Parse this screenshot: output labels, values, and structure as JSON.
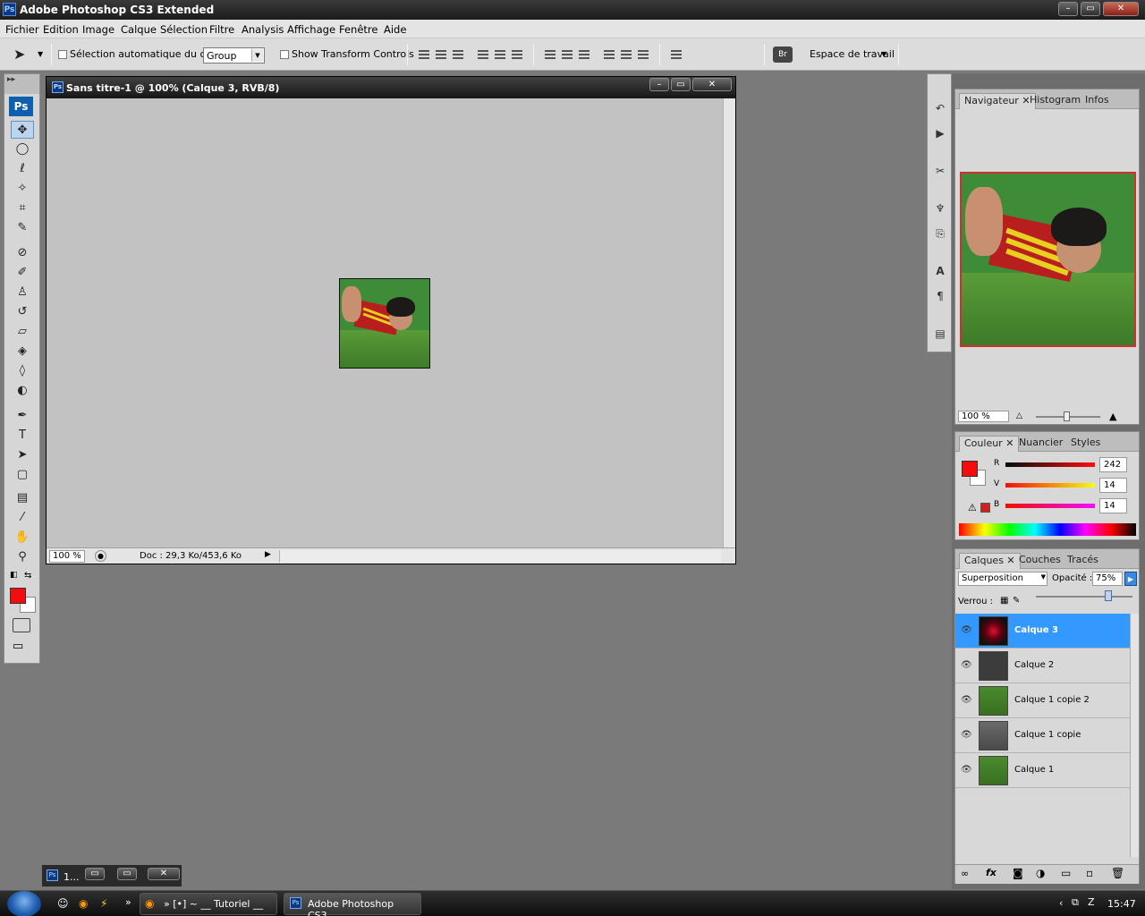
{
  "app": {
    "title": "Adobe Photoshop CS3 Extended",
    "logo": "Ps",
    "window_controls": {
      "minimize": "–",
      "maximize": "▭",
      "close": "✕"
    }
  },
  "menu": [
    "Fichier",
    "Edition",
    "Image",
    "Calque",
    "Sélection",
    "Filtre",
    "Analysis",
    "Affichage",
    "Fenêtre",
    "Aide"
  ],
  "options_bar": {
    "auto_select_label": "Sélection automatique du calque",
    "auto_select_value": "Group",
    "transform_label": "Show Transform Controls",
    "workspace_label": "Espace de travail"
  },
  "tools": {
    "logo": "Ps",
    "items": [
      {
        "name": "move-tool-icon",
        "glyph": "✥"
      },
      {
        "name": "ellipse-marquee-icon",
        "glyph": "◯"
      },
      {
        "name": "lasso-icon",
        "glyph": "ℓ"
      },
      {
        "name": "magic-wand-icon",
        "glyph": "✧"
      },
      {
        "name": "crop-icon",
        "glyph": "⌗"
      },
      {
        "name": "slice-icon",
        "glyph": "✎"
      },
      {
        "name": "healing-brush-icon",
        "glyph": "⊘"
      },
      {
        "name": "brush-icon",
        "glyph": "✐"
      },
      {
        "name": "clone-stamp-icon",
        "glyph": "♙"
      },
      {
        "name": "history-brush-icon",
        "glyph": "↺"
      },
      {
        "name": "eraser-icon",
        "glyph": "▱"
      },
      {
        "name": "paint-bucket-icon",
        "glyph": "◈"
      },
      {
        "name": "blur-icon",
        "glyph": "◊"
      },
      {
        "name": "dodge-icon",
        "glyph": "◐"
      },
      {
        "name": "pen-icon",
        "glyph": "✒"
      },
      {
        "name": "type-icon",
        "glyph": "T"
      },
      {
        "name": "path-select-icon",
        "glyph": "➤"
      },
      {
        "name": "rectangle-shape-icon",
        "glyph": "▢"
      },
      {
        "name": "notes-icon",
        "glyph": "▤"
      },
      {
        "name": "eyedropper-icon",
        "glyph": "⁄"
      },
      {
        "name": "hand-icon",
        "glyph": "✋"
      },
      {
        "name": "zoom-icon",
        "glyph": "⚲"
      }
    ],
    "foreground_color": "#f20e0e",
    "background_color": "#ffffff"
  },
  "document": {
    "title": "Sans titre-1 @ 100% (Calque 3, RVB/8)",
    "icon": "Ps",
    "zoom": "100 %",
    "doc_info": "Doc : 29,3 Ko/453,6 Ko"
  },
  "navigator": {
    "tabs": [
      "Navigateur",
      "Histogram",
      "Infos"
    ],
    "zoom": "100 %"
  },
  "color": {
    "tabs": [
      "Couleur",
      "Nuancier",
      "Styles"
    ],
    "channels": [
      {
        "label": "R",
        "value": "242"
      },
      {
        "label": "V",
        "value": "14"
      },
      {
        "label": "B",
        "value": "14"
      }
    ]
  },
  "layers": {
    "tabs": [
      "Calques",
      "Couches",
      "Tracés"
    ],
    "blend_mode": "Superposition",
    "opacity_label": "Opacité :",
    "opacity_value": "75%",
    "lock_label": "Verrou :",
    "items": [
      {
        "name": "Calque 3",
        "selected": true
      },
      {
        "name": "Calque 2",
        "selected": false
      },
      {
        "name": "Calque 1 copie 2",
        "selected": false
      },
      {
        "name": "Calque 1 copie",
        "selected": false
      },
      {
        "name": "Calque 1",
        "selected": false
      }
    ]
  },
  "minimized_doc": {
    "label": "1..."
  },
  "taskbar": {
    "buttons": [
      "» [•] ~ __ Tutoriel __ ...",
      "Adobe Photoshop CS3..."
    ],
    "clock": "15:47"
  }
}
